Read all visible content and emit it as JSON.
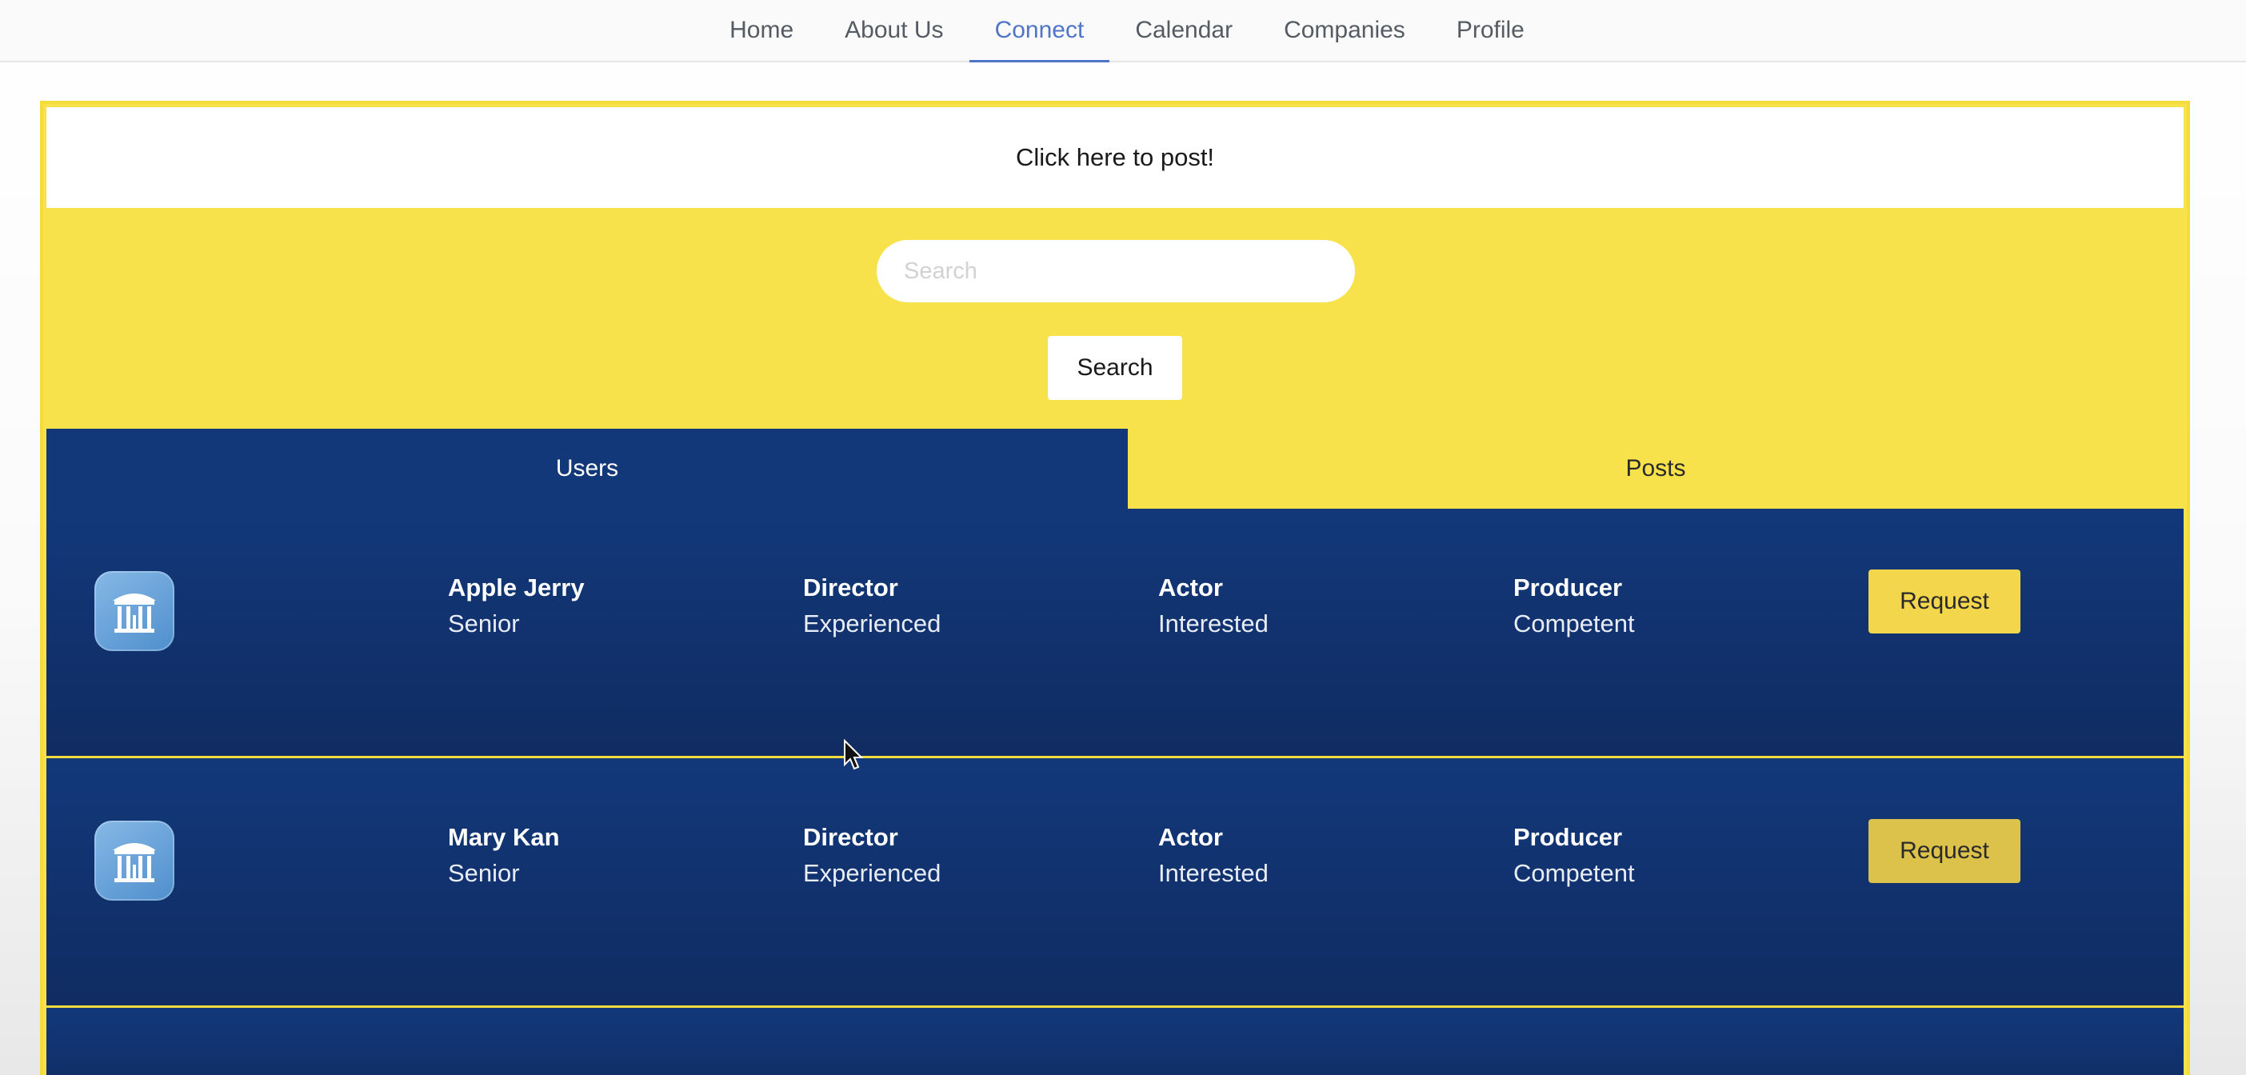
{
  "nav": {
    "items": [
      {
        "label": "Home"
      },
      {
        "label": "About Us"
      },
      {
        "label": "Connect"
      },
      {
        "label": "Calendar"
      },
      {
        "label": "Companies"
      },
      {
        "label": "Profile"
      }
    ],
    "active": "Connect"
  },
  "post_banner": {
    "label": "Click here to post!"
  },
  "search": {
    "placeholder": "Search",
    "value": "",
    "button_label": "Search"
  },
  "tabs": {
    "users_label": "Users",
    "posts_label": "Posts",
    "active": "Users"
  },
  "users": [
    {
      "name": "Apple Jerry",
      "level": "Senior",
      "roles": [
        {
          "title": "Director",
          "skill": "Experienced"
        },
        {
          "title": "Actor",
          "skill": "Interested"
        },
        {
          "title": "Producer",
          "skill": "Competent"
        }
      ],
      "button_label": "Request",
      "avatar_icon": "old-well-icon"
    },
    {
      "name": "Mary Kan",
      "level": "Senior",
      "roles": [
        {
          "title": "Director",
          "skill": "Experienced"
        },
        {
          "title": "Actor",
          "skill": "Interested"
        },
        {
          "title": "Producer",
          "skill": "Competent"
        }
      ],
      "button_label": "Request",
      "avatar_icon": "old-well-icon"
    }
  ],
  "colors": {
    "panel_yellow": "#f8e24c",
    "navy": "#12387a",
    "request_yellow": "#f3d64c",
    "nav_active": "#4f74c8"
  }
}
